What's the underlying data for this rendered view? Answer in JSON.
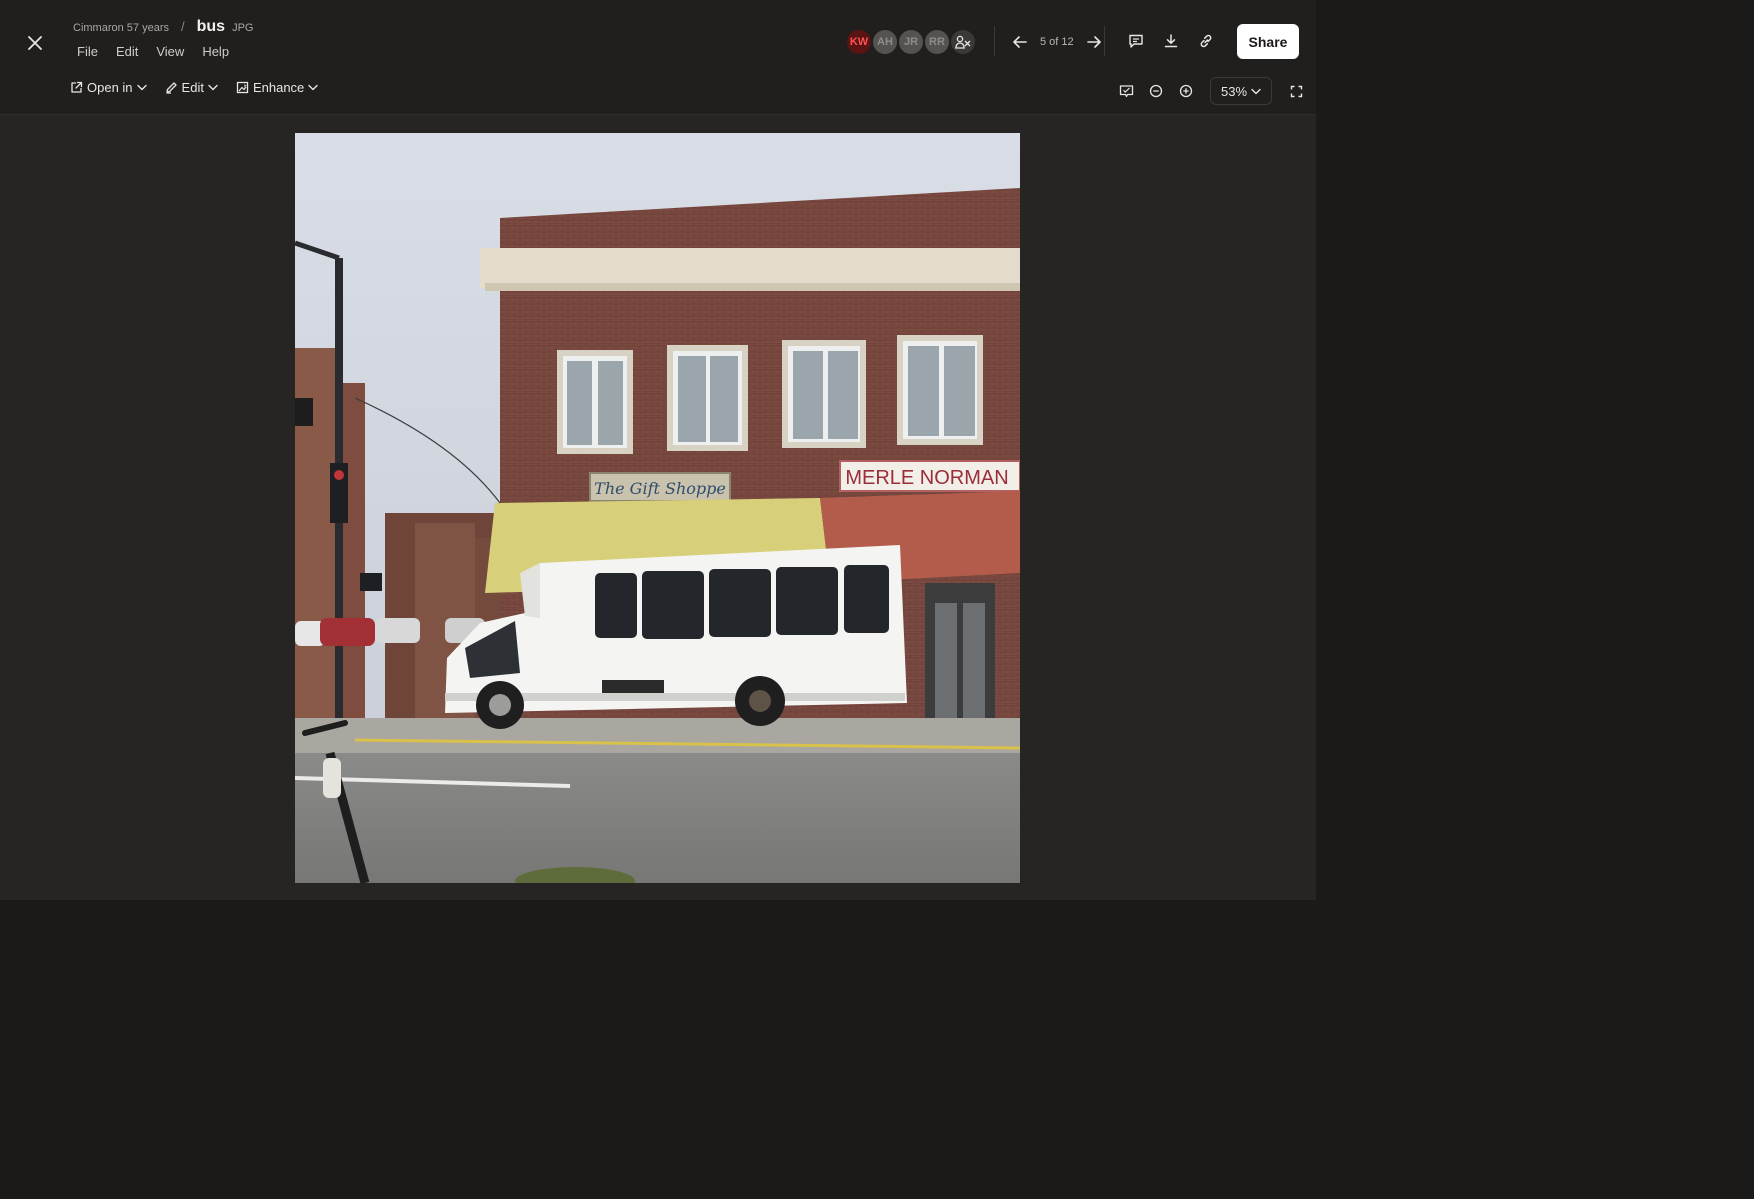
{
  "breadcrumb": {
    "folder": "Cimmaron 57 years",
    "separator": "/",
    "file_name": "bus",
    "file_type": "JPG"
  },
  "menu": [
    "File",
    "Edit",
    "View",
    "Help"
  ],
  "collaborators": [
    {
      "initials": "KW",
      "color": "#ff5252"
    },
    {
      "initials": "AH"
    },
    {
      "initials": "JR"
    },
    {
      "initials": "RR"
    }
  ],
  "pager": {
    "label": "5 of 12"
  },
  "share": {
    "label": "Share"
  },
  "toolbar": {
    "open_in": "Open in",
    "edit": "Edit",
    "enhance": "Enhance"
  },
  "zoom": {
    "level": "53%"
  },
  "photo": {
    "subject": "White shuttle bus on downtown street",
    "sign_gift_shop": "The Gift Shoppe",
    "sign_store": "MERLE NORMAN"
  }
}
